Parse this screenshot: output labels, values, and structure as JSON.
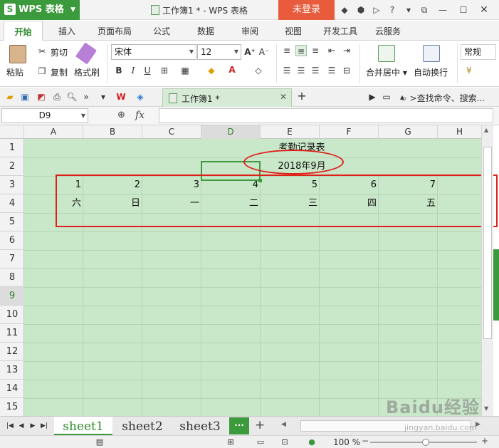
{
  "app": {
    "name": "WPS 表格",
    "logo_letter": "S"
  },
  "window": {
    "title": "工作簿1 * - WPS 表格",
    "login_label": "未登录"
  },
  "ribbon_tabs": [
    "开始",
    "插入",
    "页面布局",
    "公式",
    "数据",
    "审阅",
    "视图",
    "开发工具",
    "云服务"
  ],
  "active_tab": "开始",
  "ribbon": {
    "paste_label": "粘贴",
    "cut_label": "剪切",
    "copy_label": "复制",
    "format_painter_label": "格式刷",
    "font_name": "宋体",
    "font_size": "12",
    "merge_center_label": "合并居中",
    "wrap_text_label": "自动换行",
    "number_format": "常规"
  },
  "doc_tab": {
    "label": "工作簿1 *"
  },
  "search_cmd": "查找命令、搜索...",
  "formula_bar": {
    "name_box": "D9",
    "fx": "fx",
    "value": ""
  },
  "columns": [
    "A",
    "B",
    "C",
    "D",
    "E",
    "F",
    "G",
    "H"
  ],
  "selected_column": "D",
  "rows": [
    "1",
    "2",
    "3",
    "4",
    "5",
    "6",
    "7",
    "8",
    "9",
    "10",
    "11",
    "12",
    "13",
    "14",
    "15"
  ],
  "selected_row": "9",
  "cells": {
    "title": "考勤记录表",
    "month": "2018年9月",
    "dates": [
      "1",
      "2",
      "3",
      "4",
      "5",
      "6",
      "7"
    ],
    "weekdays": [
      "六",
      "日",
      "一",
      "二",
      "三",
      "四",
      "五"
    ]
  },
  "sheets": [
    "sheet1",
    "sheet2",
    "sheet3"
  ],
  "active_sheet": "sheet1",
  "more_sheets_label": "···",
  "add_sheet_label": "+",
  "status": {
    "zoom": "100 %"
  },
  "watermark": {
    "brand": "Baidu经验",
    "url": "jingyan.baidu.com"
  },
  "colors": {
    "accent": "#3b9a3b",
    "login": "#e85b3d",
    "grid_bg": "#c9e7c9",
    "annotation": "#e0201b"
  }
}
